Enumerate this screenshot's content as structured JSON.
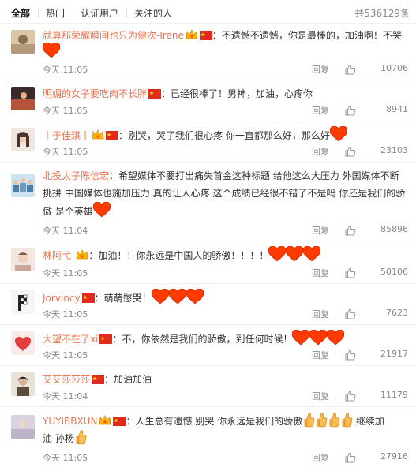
{
  "filter": {
    "tabs": [
      "全部",
      "热门",
      "认证用户",
      "关注的人"
    ],
    "total": "共536129条"
  },
  "comments": [
    {
      "user": "就算那荣耀瞬间也只为健次-Irene",
      "text": "：不遗憾不遗憾，你是最棒的，加油啊！不哭",
      "time": "今天 11:05",
      "reply": "回复",
      "likes": "10706"
    },
    {
      "user": "明媚的女子要吃肉不长胖",
      "text": "：已经很棒了！男神，加油，心疼你",
      "time": "今天 11:05",
      "reply": "回复",
      "likes": "8941"
    },
    {
      "user": "丨于佳琪丨",
      "text": "：别哭，哭了我们很心疼 你一直都那么好，那么好",
      "time": "今天 11:05",
      "reply": "回复",
      "likes": "23103"
    },
    {
      "user": "北投太子陈信宏",
      "text": "：希望媒体不要打出痛失首金这种标题 给他这么大压力 外国媒体不断",
      "text2": "挑拼 中国媒体也施加压力 真的让人心疼 这个成绩已经很不错了不是吗 你还是我们的骄",
      "text3": "傲 是个英雄",
      "time": "今天 11:04",
      "reply": "回复",
      "likes": "85896"
    },
    {
      "user": "林阿弋-",
      "text": "：加油！！你永远是中国人的骄傲！！！！",
      "time": "今天 11:05",
      "reply": "回复",
      "likes": "50106"
    },
    {
      "user": "Jorvincy",
      "text": "：萌萌憋哭！",
      "time": "今天 11:05",
      "reply": "回复",
      "likes": "7623"
    },
    {
      "user": "大望不在了xi",
      "text": "：不，你依然是我们的骄傲，到任何时候！",
      "time": "今天 11:05",
      "reply": "回复",
      "likes": "21917"
    },
    {
      "user": "艾艾莎莎莎",
      "text": "：加油加油",
      "time": "今天 11:04",
      "reply": "回复",
      "likes": "11179"
    },
    {
      "user": "YUYIBBXUN",
      "text": "：人生总有遗憾 别哭 你永远是我们的骄傲",
      "text_after": "继续加",
      "text2": "油 孙杨",
      "time": "今天 11:05",
      "reply": "回复",
      "likes": "27916"
    }
  ],
  "colors": {
    "username": "#eb7350",
    "meta": "#888888",
    "heart": "#ff3b00"
  }
}
